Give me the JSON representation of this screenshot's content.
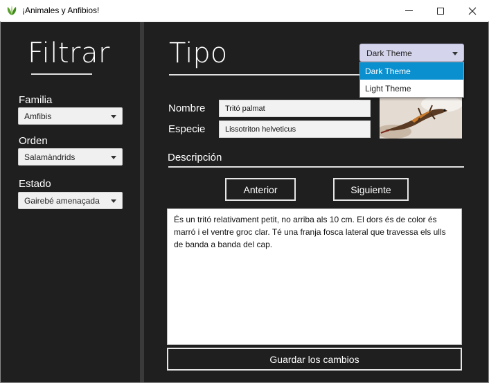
{
  "window": {
    "title": "¡Animales y Anfibios!",
    "minimize_label": "—",
    "maximize_label": "☐",
    "close_label": "✕"
  },
  "left_panel": {
    "title": "Filtrar",
    "filters": [
      {
        "label": "Familia",
        "value": "Amfibis"
      },
      {
        "label": "Orden",
        "value": "Salamàndrids"
      },
      {
        "label": "Estado",
        "value": "Gairebé amenaçada"
      }
    ]
  },
  "right_panel": {
    "title": "Tipo",
    "theme": {
      "selected": "Dark Theme",
      "options": [
        "Dark Theme",
        "Light Theme"
      ],
      "highlighted_index": 0
    },
    "fields": {
      "nombre_label": "Nombre",
      "nombre_value": "Tritó palmat",
      "especie_label": "Especie",
      "especie_value": "Lissotriton helveticus"
    },
    "description_label": "Descripción",
    "prev_button": "Anterior",
    "next_button": "Siguiente",
    "description_text": "És un tritó relativament petit, no arriba als 10 cm. El dors és de color és marró i el ventre groc clar. Té una franja fosca lateral que travessa els ulls de banda a banda del cap.",
    "save_button": "Guardar los cambios"
  },
  "colors": {
    "background": "#1f1f1f",
    "theme_combo": "#d4d4ec",
    "selection": "#0a8fcf"
  }
}
